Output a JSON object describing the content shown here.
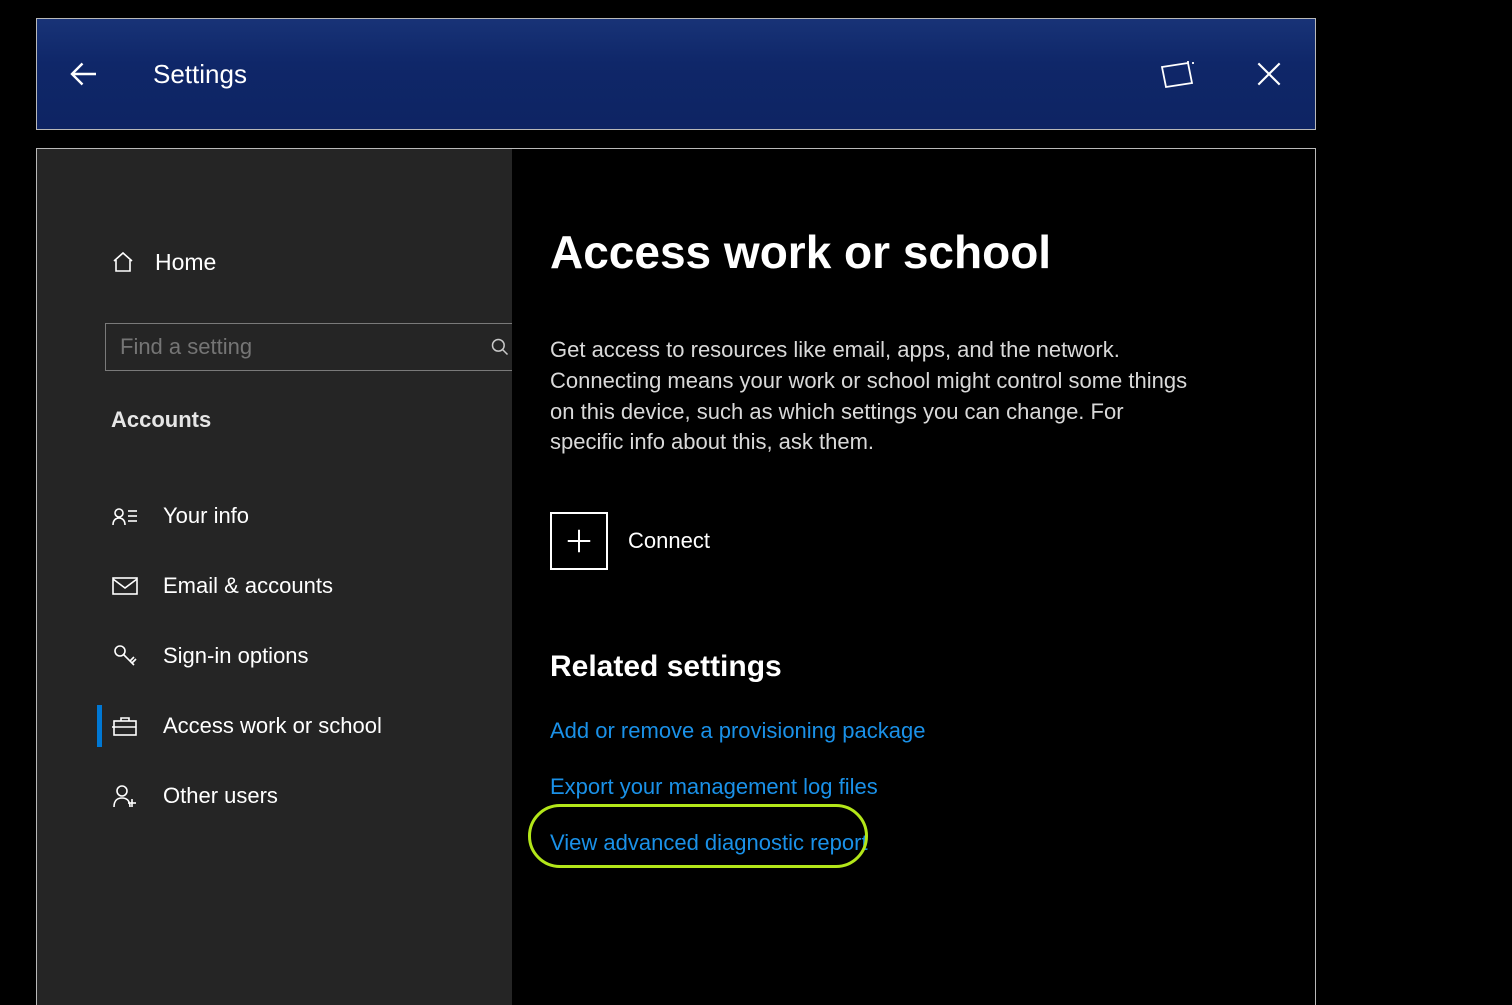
{
  "titlebar": {
    "title": "Settings"
  },
  "sidebar": {
    "home_label": "Home",
    "search_placeholder": "Find a setting",
    "section_label": "Accounts",
    "items": [
      {
        "label": "Your info"
      },
      {
        "label": "Email & accounts"
      },
      {
        "label": "Sign-in options"
      },
      {
        "label": "Access work or school"
      },
      {
        "label": "Other users"
      }
    ]
  },
  "main": {
    "heading": "Access work or school",
    "description": "Get access to resources like email, apps, and the network. Connecting means your work or school might control some things on this device, such as which settings you can change. For specific info about this, ask them.",
    "connect_label": "Connect",
    "related_heading": "Related settings",
    "related_links": [
      "Add or remove a provisioning package",
      "Export your management log files",
      "View advanced diagnostic report"
    ]
  },
  "colors": {
    "link": "#1a91e8",
    "accent": "#0078d4",
    "highlight": "#b3e619",
    "titlebar_bg": "#0f2769"
  }
}
